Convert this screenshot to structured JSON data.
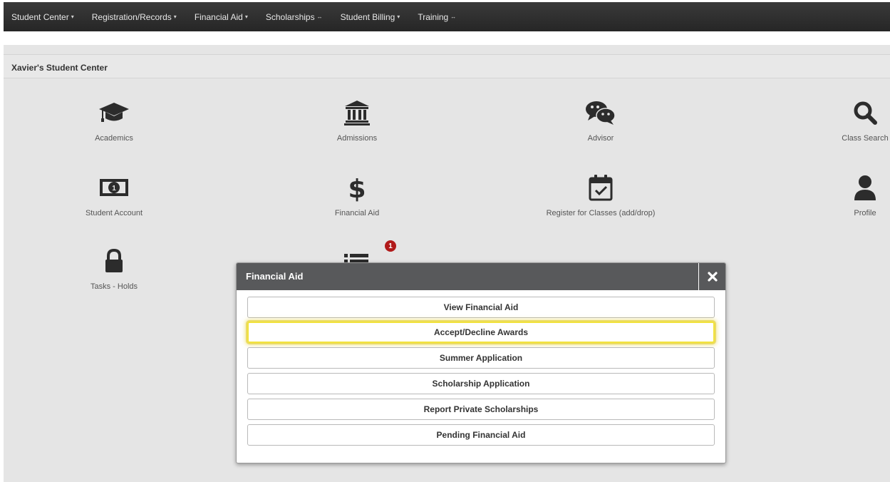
{
  "navbar": {
    "items": [
      {
        "label": "Student Center",
        "caret": "▾"
      },
      {
        "label": "Registration/Records",
        "caret": "▾"
      },
      {
        "label": "Financial Aid",
        "caret": "▾"
      },
      {
        "label": "Scholarships",
        "caret": "↔"
      },
      {
        "label": "Student Billing",
        "caret": "▾"
      },
      {
        "label": "Training",
        "caret": "↔"
      }
    ]
  },
  "page": {
    "title": "Xavier's Student Center"
  },
  "tiles": [
    {
      "label": "Academics",
      "icon": "graduation-cap-icon"
    },
    {
      "label": "Admissions",
      "icon": "institution-icon"
    },
    {
      "label": "Advisor",
      "icon": "chat-bubbles-icon"
    },
    {
      "label": "Class Search",
      "icon": "search-icon"
    },
    {
      "label": "Student Account",
      "icon": "money-bill-icon"
    },
    {
      "label": "Financial Aid",
      "icon": "dollar-icon"
    },
    {
      "label": "Register for Classes (add/drop)",
      "icon": "calendar-check-icon"
    },
    {
      "label": "Profile",
      "icon": "user-icon"
    },
    {
      "label": "Tasks - Holds",
      "icon": "lock-icon"
    },
    {
      "label": "",
      "icon": "list-icon",
      "badge": "1"
    }
  ],
  "modal": {
    "title": "Financial Aid",
    "close_icon": "close-icon",
    "buttons": [
      {
        "label": "View Financial Aid"
      },
      {
        "label": "Accept/Decline Awards",
        "highlighted": true
      },
      {
        "label": "Summer Application"
      },
      {
        "label": "Scholarship Application"
      },
      {
        "label": "Report Private Scholarships"
      },
      {
        "label": "Pending Financial Aid"
      }
    ]
  },
  "colors": {
    "navbar_bg": "#2e2e2e",
    "content_bg": "#e5e5e5",
    "modal_header_bg": "#58595b",
    "badge_red": "#b11a1a",
    "highlight_yellow": "#f2e23c"
  }
}
